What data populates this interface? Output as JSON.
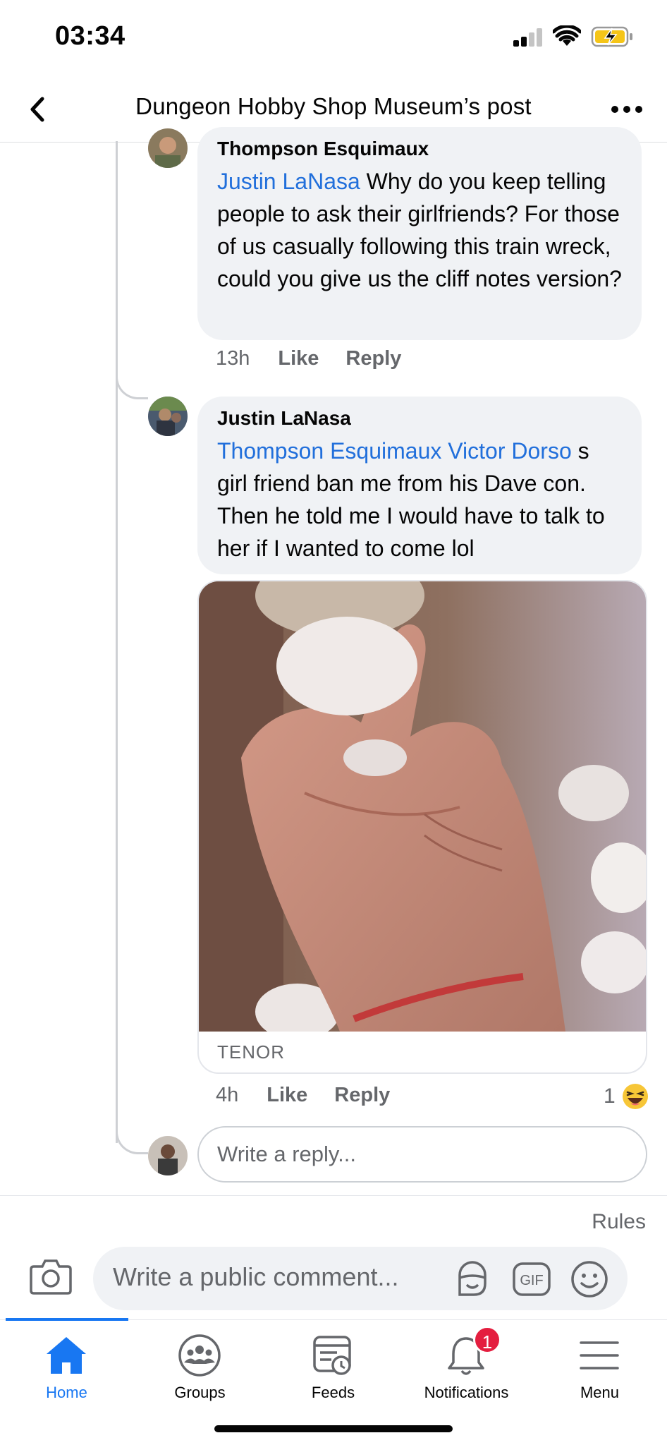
{
  "status_bar": {
    "time": "03:34"
  },
  "header": {
    "title": "Dungeon Hobby Shop Museum’s post"
  },
  "comments": [
    {
      "author": "Thompson Esquimaux",
      "mention": "Justin LaNasa",
      "text": " Why do you keep telling people to ask their girlfriends? For those of us casually following this train wreck, could you give us the cliff notes version?",
      "time": "13h",
      "like_label": "Like",
      "reply_label": "Reply"
    },
    {
      "author": "Justin LaNasa",
      "mention": "Thompson Esquimaux Victor Dorso",
      "text": " s girl friend ban me from his Dave con. Then he told me I would have to talk to her if I wanted to come lol",
      "gif_source": "TENOR",
      "time": "4h",
      "like_label": "Like",
      "reply_label": "Reply",
      "reaction_count": "1",
      "reaction_icon": "laugh-emoji"
    }
  ],
  "reply_box": {
    "placeholder": "Write a reply..."
  },
  "comment_bar": {
    "rules_label": "Rules",
    "placeholder": "Write a public comment...",
    "gif_label": "GIF"
  },
  "tabs": [
    {
      "label": "Home",
      "icon": "home-icon",
      "active": true
    },
    {
      "label": "Groups",
      "icon": "groups-icon"
    },
    {
      "label": "Feeds",
      "icon": "feeds-icon"
    },
    {
      "label": "Notifications",
      "icon": "bell-icon",
      "badge": "1"
    },
    {
      "label": "Menu",
      "icon": "menu-icon"
    }
  ],
  "colors": {
    "accent": "#1877f2",
    "mention": "#216fdb",
    "badge": "#e41e3f",
    "bubble": "#f0f2f5"
  }
}
